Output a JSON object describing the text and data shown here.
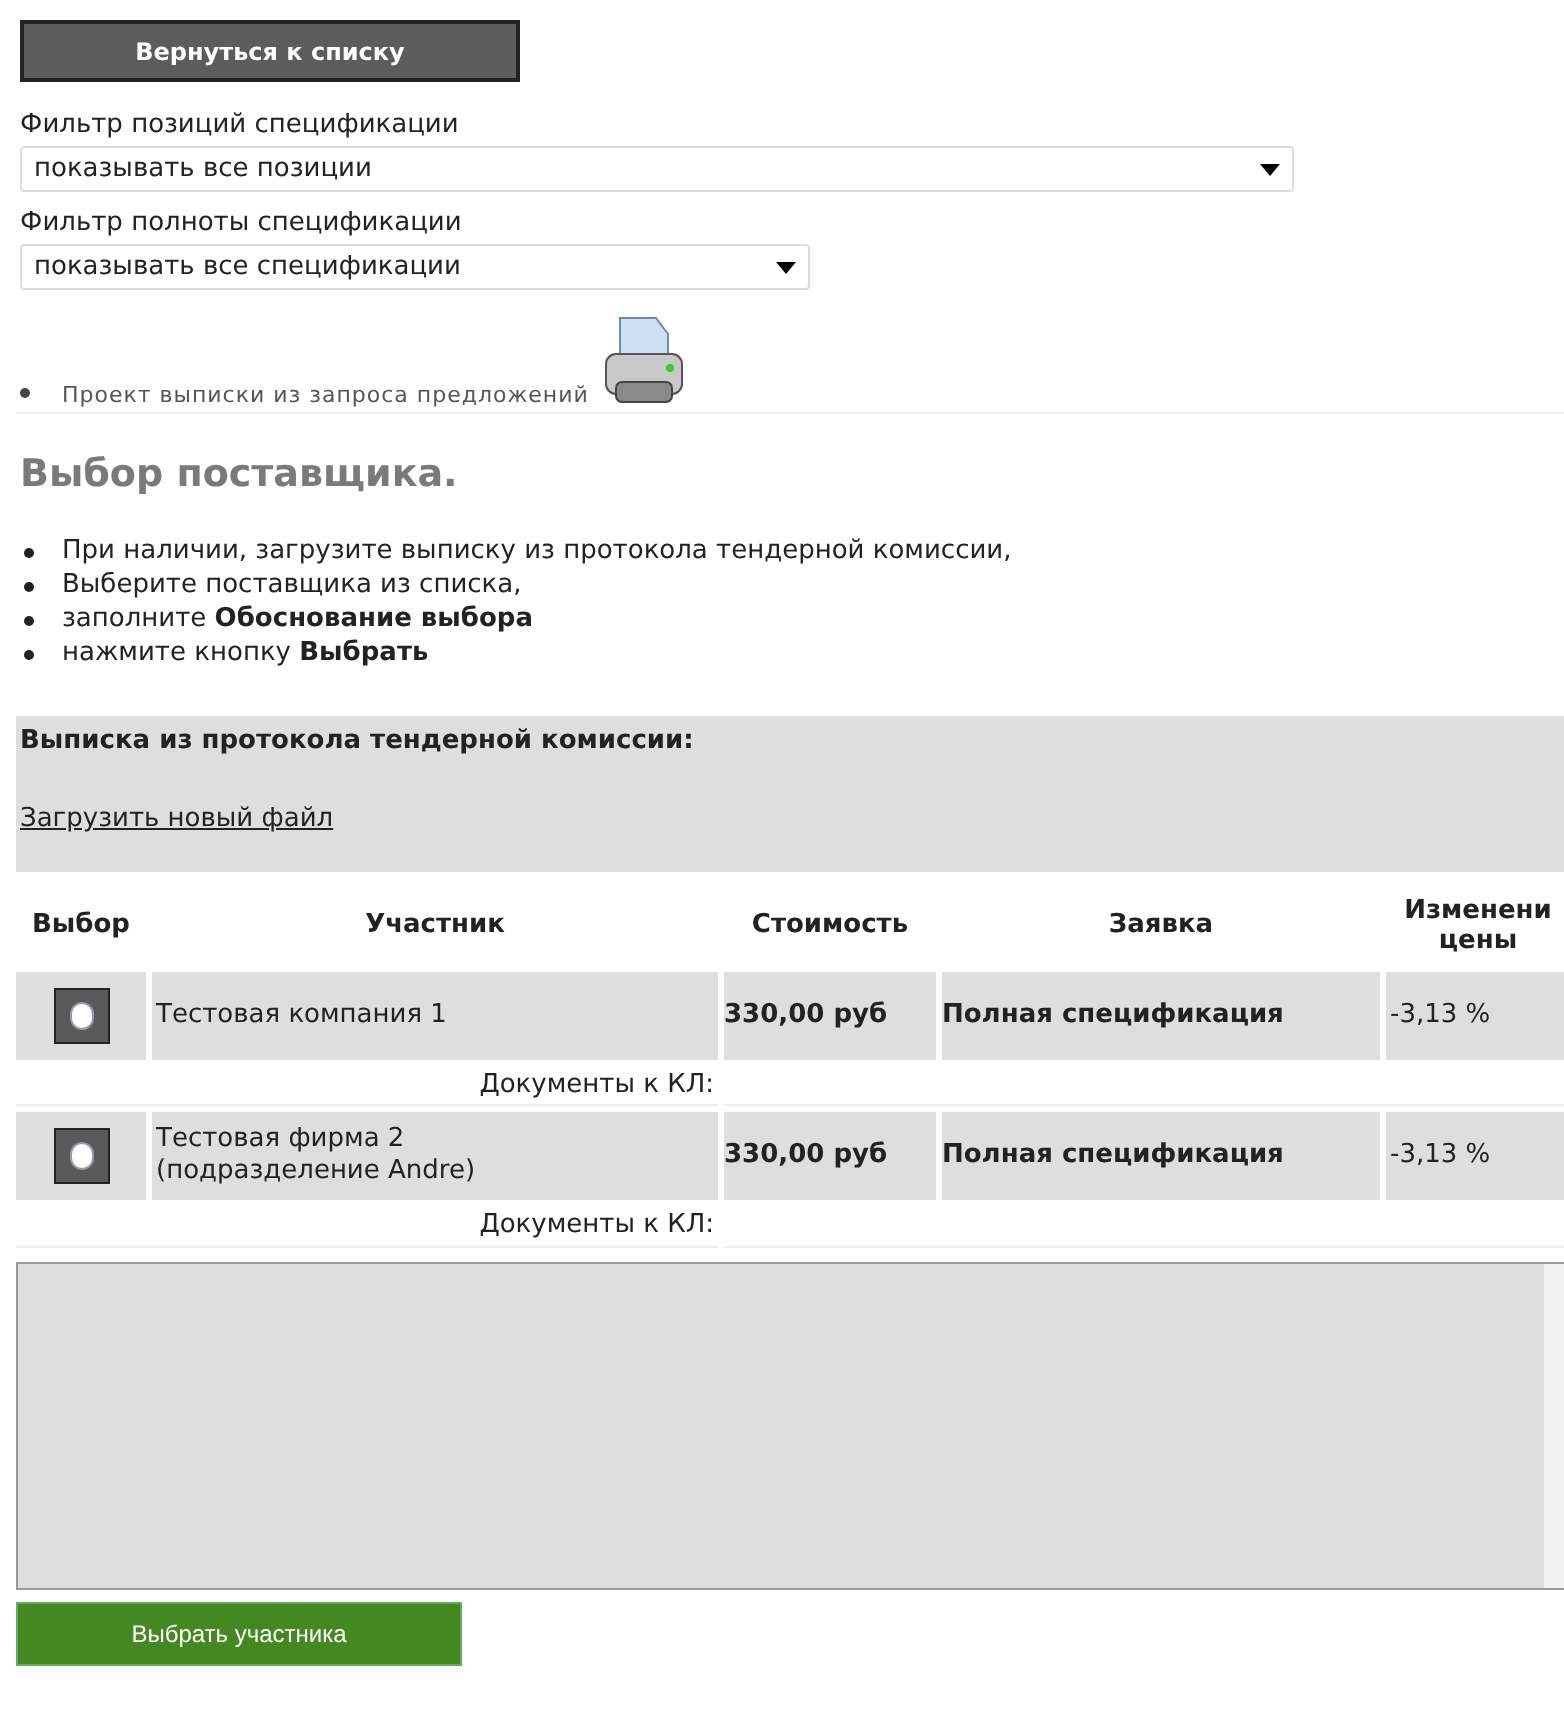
{
  "back_button": "Вернуться к списку",
  "filters": [
    {
      "label": "Фильтр позиций спецификации",
      "value": "показывать все позиции"
    },
    {
      "label": "Фильтр полноты спецификации",
      "value": "показывать все спецификации"
    }
  ],
  "print_link": "Проект выписки из запроса предложений",
  "heading": "Выбор поставщика.",
  "instructions": [
    "При наличии, загрузите выписку из протокола тендерной комиссии,",
    "Выберите поставщика из списка,",
    "заполните **Обоснование выбора**",
    "нажмите кнопку **Выбрать**"
  ],
  "protocol": {
    "title": "Выписка из протокола тендерной комиссии:",
    "upload_link": "Загрузить новый файл"
  },
  "table": {
    "columns": [
      "Выбор",
      "Участник",
      "Стоимость",
      "Заявка",
      "Изменени цены"
    ],
    "rows": [
      {
        "selected": false,
        "participant": "Тестовая компания 1",
        "cost": "330,00 руб",
        "bid": "Полная спецификация",
        "price_change": "-3,13 %",
        "docs_label": "Документы к КЛ:"
      },
      {
        "selected": false,
        "participant": "Тестовая фирма 2 (подразделение Andre)",
        "cost": "330,00 руб",
        "bid": "Полная спецификация",
        "price_change": "-3,13 %",
        "docs_label": "Документы к КЛ:"
      }
    ]
  },
  "submit_button": "Выбрать участника"
}
